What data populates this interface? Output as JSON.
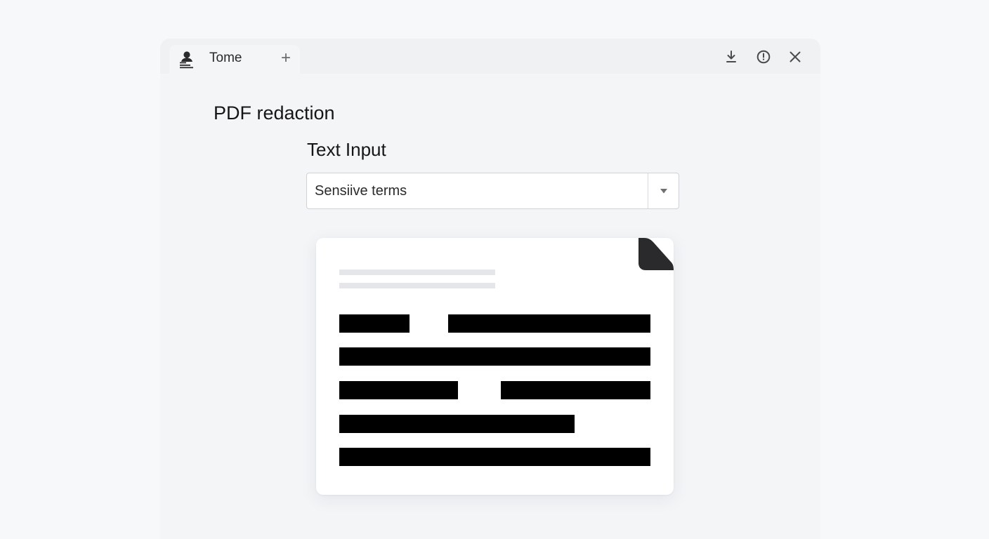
{
  "window": {
    "tab": {
      "title": "Tome",
      "icon": "user-layers-icon",
      "add_label": "+"
    },
    "controls": [
      "download-icon",
      "history-icon",
      "close-icon"
    ]
  },
  "page": {
    "title": "PDF redaction",
    "field_label": "Text Input",
    "combo": {
      "value": "Sensiive terms",
      "arrow_icon": "dropdown-arrow-icon"
    }
  },
  "document_preview": {
    "corner_icon": "page-fold-icon",
    "header_lines": 2,
    "redaction_lines": 5,
    "redaction_color": "#000000"
  },
  "colors": {
    "background": "#f6f8fa",
    "window": "#f3f5f7",
    "card": "#ffffff",
    "redaction": "#000000"
  }
}
